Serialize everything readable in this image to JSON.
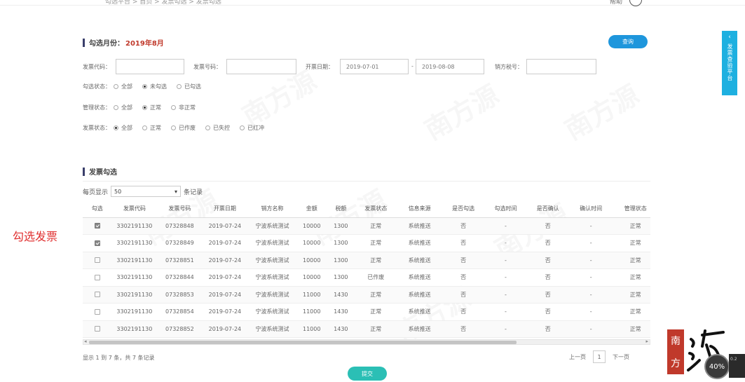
{
  "topbar": {
    "breadcrumb": "勾选平台 > 首页 > 发票勾选 > 发票勾选",
    "help_label": "帮助"
  },
  "filter": {
    "title_label": "勾选月份：",
    "month_value": "2019年8月",
    "query_button": "查询",
    "invoice_code_label": "发票代码：",
    "invoice_code_value": "",
    "invoice_number_label": "发票号码：",
    "invoice_number_value": "",
    "issue_date_label": "开票日期：",
    "date_start": "2019-07-01",
    "date_separator": "-",
    "date_end": "2019-08-08",
    "seller_tax_label": "销方税号：",
    "seller_tax_value": "",
    "check_status": {
      "label": "勾选状态：",
      "options": [
        "全部",
        "未勾选",
        "已勾选"
      ],
      "selected": 1
    },
    "manage_status": {
      "label": "管理状态：",
      "options": [
        "全部",
        "正常",
        "非正常"
      ],
      "selected": 1
    },
    "invoice_status": {
      "label": "发票状态：",
      "options": [
        "全部",
        "正常",
        "已作废",
        "已失控",
        "已红冲"
      ],
      "selected": 0
    }
  },
  "list": {
    "title": "发票勾选",
    "per_page_prefix": "每页显示",
    "per_page_value": "50",
    "per_page_suffix": "条记录",
    "columns": [
      "勾选",
      "发票代码",
      "发票号码",
      "开票日期",
      "销方名称",
      "金额",
      "税额",
      "发票状态",
      "信息来源",
      "是否勾选",
      "勾选时间",
      "是否确认",
      "确认时间",
      "管理状态"
    ],
    "rows": [
      {
        "checked": true,
        "code": "3302191130",
        "number": "07328848",
        "date": "2019-07-24",
        "seller": "宁波系统测试",
        "amount": "10000",
        "tax": "1300",
        "status": "正常",
        "source": "系统推送",
        "is_checked": "否",
        "check_time": "-",
        "confirmed": "否",
        "confirm_time": "-",
        "manage": "正常"
      },
      {
        "checked": true,
        "code": "3302191130",
        "number": "07328849",
        "date": "2019-07-24",
        "seller": "宁波系统测试",
        "amount": "10000",
        "tax": "1300",
        "status": "正常",
        "source": "系统推送",
        "is_checked": "否",
        "check_time": "-",
        "confirmed": "否",
        "confirm_time": "-",
        "manage": "正常"
      },
      {
        "checked": false,
        "code": "3302191130",
        "number": "07328851",
        "date": "2019-07-24",
        "seller": "宁波系统测试",
        "amount": "10000",
        "tax": "1300",
        "status": "正常",
        "source": "系统推送",
        "is_checked": "否",
        "check_time": "-",
        "confirmed": "否",
        "confirm_time": "-",
        "manage": "正常"
      },
      {
        "checked": false,
        "code": "3302191130",
        "number": "07328844",
        "date": "2019-07-24",
        "seller": "宁波系统测试",
        "amount": "10000",
        "tax": "1300",
        "status": "已作废",
        "source": "系统推送",
        "is_checked": "否",
        "check_time": "-",
        "confirmed": "否",
        "confirm_time": "-",
        "manage": "正常"
      },
      {
        "checked": false,
        "code": "3302191130",
        "number": "07328853",
        "date": "2019-07-24",
        "seller": "宁波系统测试",
        "amount": "11000",
        "tax": "1430",
        "status": "正常",
        "source": "系统推送",
        "is_checked": "否",
        "check_time": "-",
        "confirmed": "否",
        "confirm_time": "-",
        "manage": "正常"
      },
      {
        "checked": false,
        "code": "3302191130",
        "number": "07328854",
        "date": "2019-07-24",
        "seller": "宁波系统测试",
        "amount": "11000",
        "tax": "1430",
        "status": "正常",
        "source": "系统推送",
        "is_checked": "否",
        "check_time": "-",
        "confirmed": "否",
        "confirm_time": "-",
        "manage": "正常"
      },
      {
        "checked": false,
        "code": "3302191130",
        "number": "07328852",
        "date": "2019-07-24",
        "seller": "宁波系统测试",
        "amount": "11000",
        "tax": "1430",
        "status": "正常",
        "source": "系统推送",
        "is_checked": "否",
        "check_time": "-",
        "confirmed": "否",
        "confirm_time": "-",
        "manage": "正常"
      }
    ],
    "footer_info": "显示 1 到 7 条，共 7 条记录",
    "pager": {
      "prev": "上一页",
      "current": "1",
      "next": "下一页"
    },
    "submit_button": "提交"
  },
  "annotation": "勾选发票",
  "side_tab": {
    "label": "发票查验平台"
  },
  "logo": {
    "chars": [
      "南",
      "方"
    ]
  },
  "zoom": {
    "value": "40%",
    "side_text": "0.2"
  },
  "colors": {
    "primary": "#1e96dc",
    "submit": "#2bbfb5",
    "accent_red": "#c0392b",
    "annotation": "#e03030",
    "side_tab": "#1eb0e0"
  }
}
